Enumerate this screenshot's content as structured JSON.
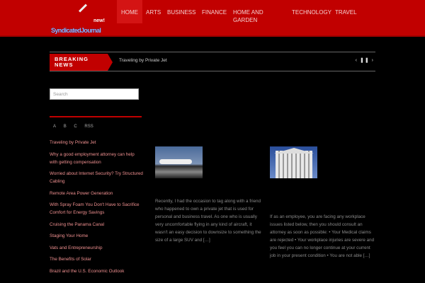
{
  "header": {
    "logo_text": "SyndicatedJournal",
    "logo_badge": "new!",
    "nav": [
      "HOME",
      "ARTS",
      "BUSINESS",
      "FINANCE",
      "HOME AND GARDEN",
      "TECHNOLOGY",
      "TRAVEL"
    ]
  },
  "breaking": {
    "label": "BREAKING NEWS",
    "ticker": "Traveling by Private Jet",
    "prev": "‹",
    "pause": "❚❚",
    "next": "›"
  },
  "sidebar": {
    "search_placeholder": "Search",
    "tabs": [
      "A",
      "B",
      "C",
      "RSS"
    ],
    "recent": [
      "Traveling by Private Jet",
      "Why a good employment attorney can help with getting compensation",
      "Worried about Internet Security? Try Structured Cabling",
      "Remote Area Power Generation",
      "With Spray Foam You Don't Have to Sacrifice Comfort for Energy Savings",
      "Cruising the Panama Canal",
      "Staging Your Home",
      "Vats and Entrepreneurship",
      "The Benefits of Solar",
      "Brazil and the U.S. Economic Outlook"
    ]
  },
  "posts": [
    {
      "excerpt": "Recently, I had the occasion to tag along with a friend who happened to own a private jet that is used for personal and business travel.  As one who is usually very uncomfortable flying in any kind of aircraft, it wasn't an easy decision to downsize to something the size of a large SUV and […]"
    },
    {
      "excerpt": "If as an employee, you are facing any workplace issues listed below, then you should consult an attorney as soon as possible: • Your Medical claims are rejected • Your workplace injuries are severe and you feel you can no longer continue at your current job in your present condition • You are not able […]"
    }
  ]
}
